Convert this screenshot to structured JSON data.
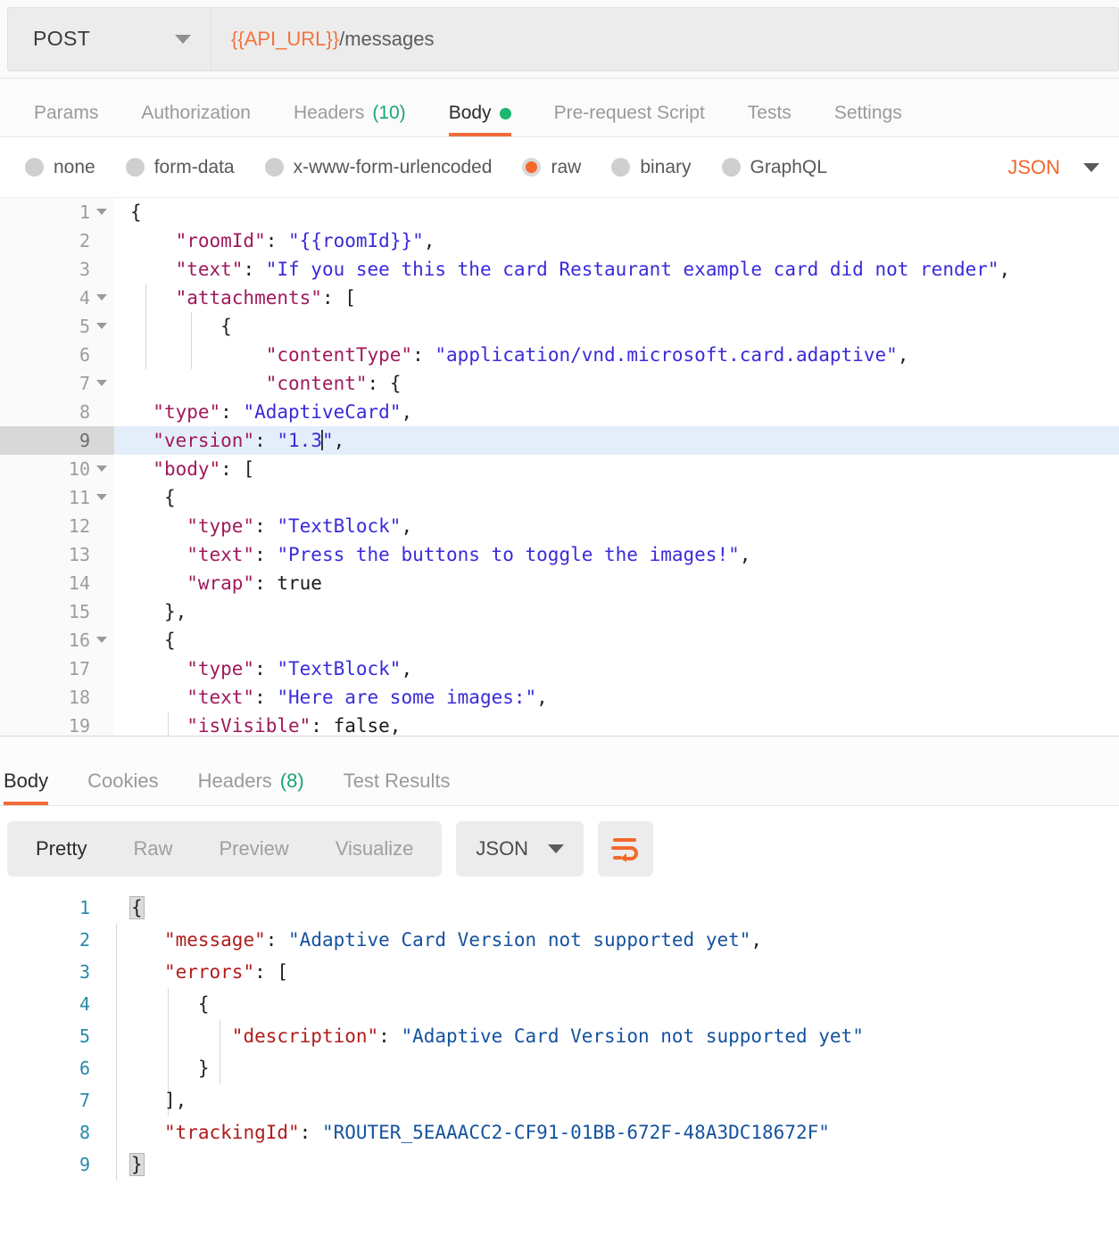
{
  "request": {
    "method": "POST",
    "method_caret": "chevron-down-icon",
    "url_variable": "{{API_URL}}",
    "url_path": "/messages",
    "tabs": [
      {
        "label": "Params",
        "active": false,
        "count": ""
      },
      {
        "label": "Authorization",
        "active": false,
        "count": ""
      },
      {
        "label": "Headers",
        "active": false,
        "count": "(10)"
      },
      {
        "label": "Body",
        "active": true,
        "count": "",
        "dot": true
      },
      {
        "label": "Pre-request Script",
        "active": false,
        "count": ""
      },
      {
        "label": "Tests",
        "active": false,
        "count": ""
      },
      {
        "label": "Settings",
        "active": false,
        "count": ""
      }
    ],
    "body_types": [
      {
        "label": "none",
        "selected": false
      },
      {
        "label": "form-data",
        "selected": false
      },
      {
        "label": "x-www-form-urlencoded",
        "selected": false
      },
      {
        "label": "raw",
        "selected": true
      },
      {
        "label": "binary",
        "selected": false
      },
      {
        "label": "GraphQL",
        "selected": false
      }
    ],
    "format_select": "JSON",
    "editor_lines": [
      {
        "n": "1",
        "fold": true,
        "hl": false
      },
      {
        "n": "2",
        "fold": false,
        "hl": false
      },
      {
        "n": "3",
        "fold": false,
        "hl": false
      },
      {
        "n": "4",
        "fold": true,
        "hl": false
      },
      {
        "n": "5",
        "fold": true,
        "hl": false
      },
      {
        "n": "6",
        "fold": false,
        "hl": false
      },
      {
        "n": "7",
        "fold": true,
        "hl": false
      },
      {
        "n": "8",
        "fold": false,
        "hl": false
      },
      {
        "n": "9",
        "fold": false,
        "hl": true
      },
      {
        "n": "10",
        "fold": true,
        "hl": false
      },
      {
        "n": "11",
        "fold": true,
        "hl": false
      },
      {
        "n": "12",
        "fold": false,
        "hl": false
      },
      {
        "n": "13",
        "fold": false,
        "hl": false
      },
      {
        "n": "14",
        "fold": false,
        "hl": false
      },
      {
        "n": "15",
        "fold": false,
        "hl": false
      },
      {
        "n": "16",
        "fold": true,
        "hl": false
      },
      {
        "n": "17",
        "fold": false,
        "hl": false
      },
      {
        "n": "18",
        "fold": false,
        "hl": false
      },
      {
        "n": "19",
        "fold": false,
        "hl": false
      }
    ],
    "editor_text": {
      "l1": "{",
      "l2_key": "\"roomId\"",
      "l2_val": "\"{{roomId}}\"",
      "l3_key": "\"text\"",
      "l3_val": "\"If you see this the card Restaurant example card did not render\"",
      "l4_key": "\"attachments\"",
      "l4_open": "[",
      "l5": "{",
      "l6_key": "\"contentType\"",
      "l6_val": "\"application/vnd.microsoft.card.adaptive\"",
      "l7_key": "\"content\"",
      "l7_open": "{",
      "l8_key": "\"type\"",
      "l8_val": "\"AdaptiveCard\"",
      "l9_key": "\"version\"",
      "l9_val_a": "\"1.3",
      "l9_val_b": "\"",
      "l10_key": "\"body\"",
      "l10_open": "[",
      "l11": "{",
      "l12_key": "\"type\"",
      "l12_val": "\"TextBlock\"",
      "l13_key": "\"text\"",
      "l13_val": "\"Press the buttons to toggle the images!\"",
      "l14_key": "\"wrap\"",
      "l14_val": "true",
      "l15": "},",
      "l16": "{",
      "l17_key": "\"type\"",
      "l17_val": "\"TextBlock\"",
      "l18_key": "\"text\"",
      "l18_val": "\"Here are some images:\"",
      "l19_key": "\"isVisible\"",
      "l19_val": "false,"
    }
  },
  "response": {
    "tabs": [
      {
        "label": "Body",
        "active": true,
        "count": ""
      },
      {
        "label": "Cookies",
        "active": false,
        "count": ""
      },
      {
        "label": "Headers",
        "active": false,
        "count": "(8)"
      },
      {
        "label": "Test Results",
        "active": false,
        "count": ""
      }
    ],
    "view_modes": [
      {
        "label": "Pretty",
        "active": true
      },
      {
        "label": "Raw",
        "active": false
      },
      {
        "label": "Preview",
        "active": false
      },
      {
        "label": "Visualize",
        "active": false
      }
    ],
    "format_select": "JSON",
    "wrap_button_icon": "word-wrap-icon",
    "editor_lines": [
      {
        "n": "1"
      },
      {
        "n": "2"
      },
      {
        "n": "3"
      },
      {
        "n": "4"
      },
      {
        "n": "5"
      },
      {
        "n": "6"
      },
      {
        "n": "7"
      },
      {
        "n": "8"
      },
      {
        "n": "9"
      }
    ],
    "editor_text": {
      "l1": "{",
      "l2_key": "\"message\"",
      "l2_val": "\"Adaptive Card Version not supported yet\"",
      "l3_key": "\"errors\"",
      "l3_open": "[",
      "l4": "{",
      "l5_key": "\"description\"",
      "l5_val": "\"Adaptive Card Version not supported yet\"",
      "l6": "}",
      "l7": "],",
      "l8_key": "\"trackingId\"",
      "l8_val": "\"ROUTER_5EAAACC2-CF91-01BB-672F-48A3DC18672F\"",
      "l9": "}"
    }
  },
  "colors": {
    "accent_orange": "#f26b3a",
    "green": "#1bb76e",
    "request_key": "#a0195b",
    "request_string": "#3a2bd9",
    "response_key": "#b01c1c",
    "response_string": "#15529e",
    "highlight_line": "#e4eefb"
  }
}
